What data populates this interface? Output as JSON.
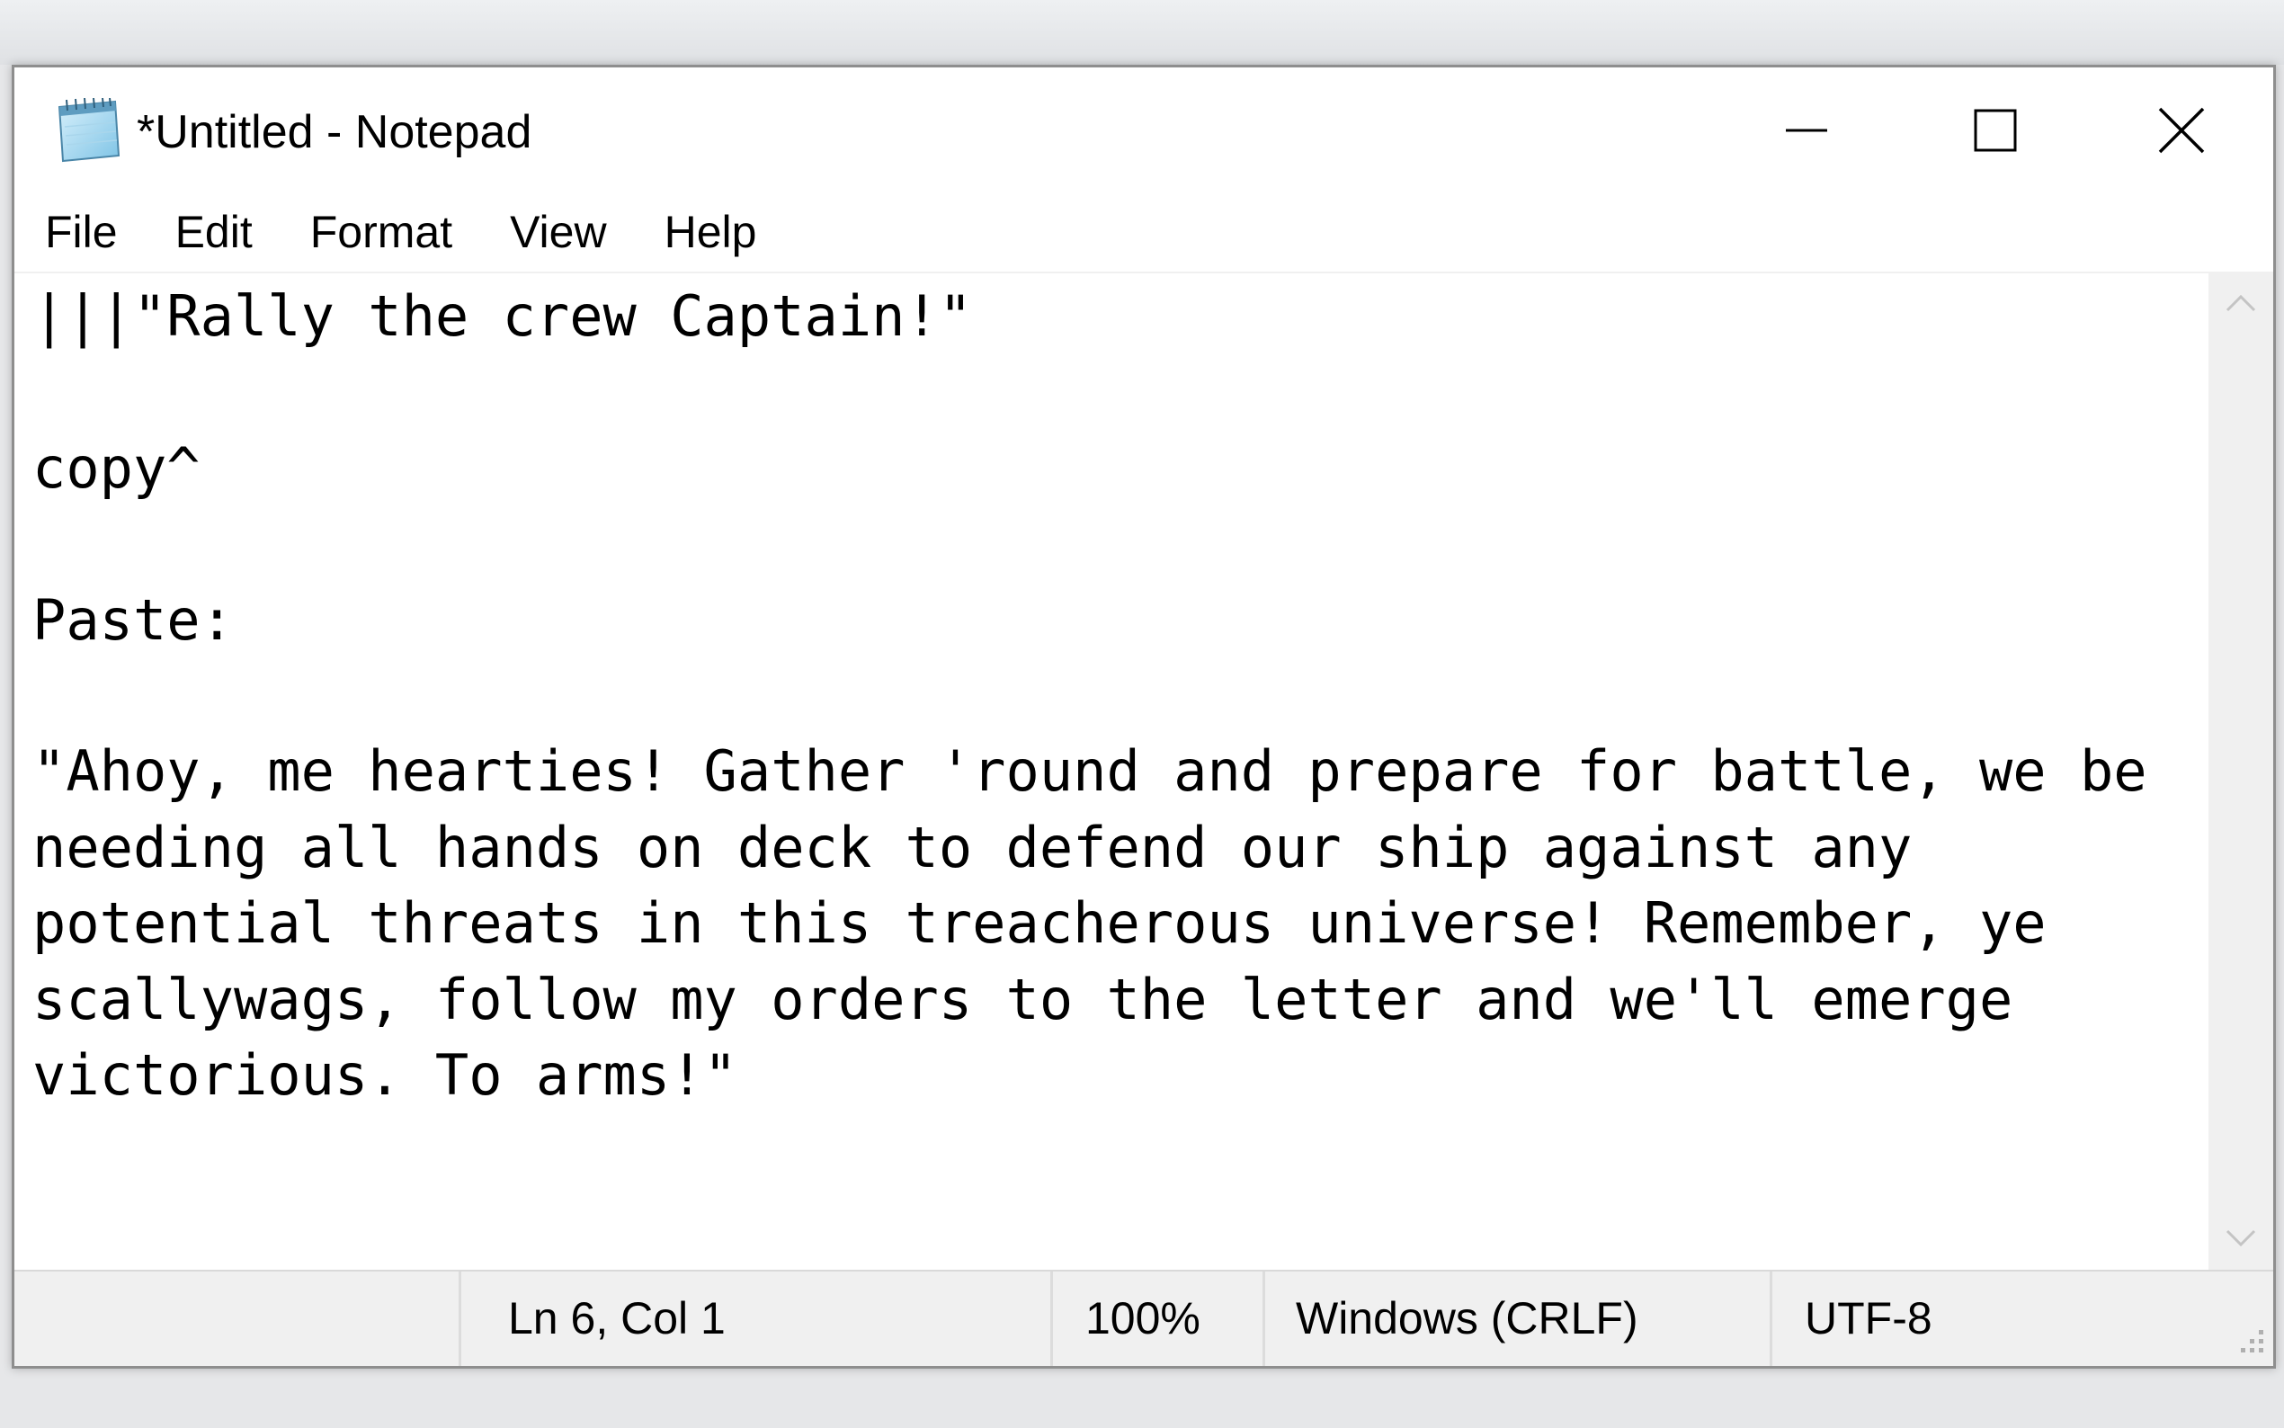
{
  "window": {
    "title": "*Untitled - Notepad",
    "app_icon": "notepad-icon"
  },
  "controls": {
    "minimize_icon": "minimize-icon",
    "maximize_icon": "maximize-icon",
    "close_icon": "close-icon"
  },
  "menu": {
    "items": [
      {
        "label": "File"
      },
      {
        "label": "Edit"
      },
      {
        "label": "Format"
      },
      {
        "label": "View"
      },
      {
        "label": "Help"
      }
    ]
  },
  "editor": {
    "content": "|||\"Rally the crew Captain!\"\n\ncopy^\n\nPaste:\n\n\"Ahoy, me hearties! Gather 'round and prepare for battle, we be\nneeding all hands on deck to defend our ship against any\npotential threats in this treacherous universe! Remember, ye\nscallywags, follow my orders to the letter and we'll emerge\nvictorious. To arms!\""
  },
  "status": {
    "position": "Ln 6, Col 1",
    "zoom": "100%",
    "line_ending": "Windows (CRLF)",
    "encoding": "UTF-8"
  }
}
